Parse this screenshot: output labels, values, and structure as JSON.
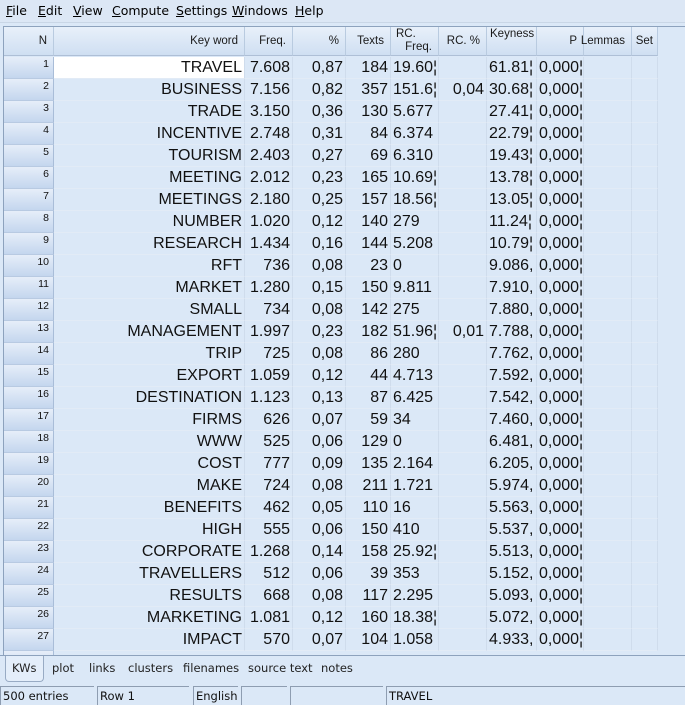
{
  "menu": [
    {
      "label": "File",
      "accel": "F",
      "rest": "ile"
    },
    {
      "label": "Edit",
      "accel": "E",
      "rest": "dit"
    },
    {
      "label": "View",
      "accel": "V",
      "rest": "iew"
    },
    {
      "label": "Compute",
      "accel": "C",
      "rest": "ompute"
    },
    {
      "label": "Settings",
      "accel": "S",
      "rest": "ettings"
    },
    {
      "label": "Windows",
      "accel": "W",
      "rest": "indows"
    },
    {
      "label": "Help",
      "accel": "H",
      "rest": "elp"
    }
  ],
  "columns": {
    "n": "N",
    "keyword": "Key word",
    "freq": "Freq.",
    "pct": "%",
    "texts": "Texts",
    "rc_freq_1": "RC.",
    "rc_freq_2": "Freq.",
    "rc_pct": "RC. %",
    "keyness": "Keyness",
    "p": "P",
    "lemmas": "Lemmas",
    "set": "Set"
  },
  "rows": [
    {
      "n": "1",
      "kw": "TRAVEL",
      "freq": "7.608",
      "pct": "0,87",
      "texts": "184",
      "rcf": "19.60¦",
      "rcp": "",
      "key": "61.81¦",
      "p": "0,000¦"
    },
    {
      "n": "2",
      "kw": "BUSINESS",
      "freq": "7.156",
      "pct": "0,82",
      "texts": "357",
      "rcf": "151.6¦",
      "rcp": "0,04",
      "key": "30.68¦",
      "p": "0,000¦"
    },
    {
      "n": "3",
      "kw": "TRADE",
      "freq": "3.150",
      "pct": "0,36",
      "texts": "130",
      "rcf": "5.677",
      "rcp": "",
      "key": "27.41¦",
      "p": "0,000¦"
    },
    {
      "n": "4",
      "kw": "INCENTIVE",
      "freq": "2.748",
      "pct": "0,31",
      "texts": "84",
      "rcf": "6.374",
      "rcp": "",
      "key": "22.79¦",
      "p": "0,000¦"
    },
    {
      "n": "5",
      "kw": "TOURISM",
      "freq": "2.403",
      "pct": "0,27",
      "texts": "69",
      "rcf": "6.310",
      "rcp": "",
      "key": "19.43¦",
      "p": "0,000¦"
    },
    {
      "n": "6",
      "kw": "MEETING",
      "freq": "2.012",
      "pct": "0,23",
      "texts": "165",
      "rcf": "10.69¦",
      "rcp": "",
      "key": "13.78¦",
      "p": "0,000¦"
    },
    {
      "n": "7",
      "kw": "MEETINGS",
      "freq": "2.180",
      "pct": "0,25",
      "texts": "157",
      "rcf": "18.56¦",
      "rcp": "",
      "key": "13.05¦",
      "p": "0,000¦"
    },
    {
      "n": "8",
      "kw": "NUMBER",
      "freq": "1.020",
      "pct": "0,12",
      "texts": "140",
      "rcf": "279",
      "rcp": "",
      "key": "11.24¦",
      "p": "0,000¦"
    },
    {
      "n": "9",
      "kw": "RESEARCH",
      "freq": "1.434",
      "pct": "0,16",
      "texts": "144",
      "rcf": "5.208",
      "rcp": "",
      "key": "10.79¦",
      "p": "0,000¦"
    },
    {
      "n": "10",
      "kw": "RFT",
      "freq": "736",
      "pct": "0,08",
      "texts": "23",
      "rcf": "0",
      "rcp": "",
      "key": "9.086,",
      "p": "0,000¦"
    },
    {
      "n": "11",
      "kw": "MARKET",
      "freq": "1.280",
      "pct": "0,15",
      "texts": "150",
      "rcf": "9.811",
      "rcp": "",
      "key": "7.910,",
      "p": "0,000¦"
    },
    {
      "n": "12",
      "kw": "SMALL",
      "freq": "734",
      "pct": "0,08",
      "texts": "142",
      "rcf": "275",
      "rcp": "",
      "key": "7.880,",
      "p": "0,000¦"
    },
    {
      "n": "13",
      "kw": "MANAGEMENT",
      "freq": "1.997",
      "pct": "0,23",
      "texts": "182",
      "rcf": "51.96¦",
      "rcp": "0,01",
      "key": "7.788,",
      "p": "0,000¦"
    },
    {
      "n": "14",
      "kw": "TRIP",
      "freq": "725",
      "pct": "0,08",
      "texts": "86",
      "rcf": "280",
      "rcp": "",
      "key": "7.762,",
      "p": "0,000¦"
    },
    {
      "n": "15",
      "kw": "EXPORT",
      "freq": "1.059",
      "pct": "0,12",
      "texts": "44",
      "rcf": "4.713",
      "rcp": "",
      "key": "7.592,",
      "p": "0,000¦"
    },
    {
      "n": "16",
      "kw": "DESTINATION",
      "freq": "1.123",
      "pct": "0,13",
      "texts": "87",
      "rcf": "6.425",
      "rcp": "",
      "key": "7.542,",
      "p": "0,000¦"
    },
    {
      "n": "17",
      "kw": "FIRMS",
      "freq": "626",
      "pct": "0,07",
      "texts": "59",
      "rcf": "34",
      "rcp": "",
      "key": "7.460,",
      "p": "0,000¦"
    },
    {
      "n": "18",
      "kw": "WWW",
      "freq": "525",
      "pct": "0,06",
      "texts": "129",
      "rcf": "0",
      "rcp": "",
      "key": "6.481,",
      "p": "0,000¦"
    },
    {
      "n": "19",
      "kw": "COST",
      "freq": "777",
      "pct": "0,09",
      "texts": "135",
      "rcf": "2.164",
      "rcp": "",
      "key": "6.205,",
      "p": "0,000¦"
    },
    {
      "n": "20",
      "kw": "MAKE",
      "freq": "724",
      "pct": "0,08",
      "texts": "211",
      "rcf": "1.721",
      "rcp": "",
      "key": "5.974,",
      "p": "0,000¦"
    },
    {
      "n": "21",
      "kw": "BENEFITS",
      "freq": "462",
      "pct": "0,05",
      "texts": "110",
      "rcf": "16",
      "rcp": "",
      "key": "5.563,",
      "p": "0,000¦"
    },
    {
      "n": "22",
      "kw": "HIGH",
      "freq": "555",
      "pct": "0,06",
      "texts": "150",
      "rcf": "410",
      "rcp": "",
      "key": "5.537,",
      "p": "0,000¦"
    },
    {
      "n": "23",
      "kw": "CORPORATE",
      "freq": "1.268",
      "pct": "0,14",
      "texts": "158",
      "rcf": "25.92¦",
      "rcp": "",
      "key": "5.513,",
      "p": "0,000¦"
    },
    {
      "n": "24",
      "kw": "TRAVELLERS",
      "freq": "512",
      "pct": "0,06",
      "texts": "39",
      "rcf": "353",
      "rcp": "",
      "key": "5.152,",
      "p": "0,000¦"
    },
    {
      "n": "25",
      "kw": "RESULTS",
      "freq": "668",
      "pct": "0,08",
      "texts": "117",
      "rcf": "2.295",
      "rcp": "",
      "key": "5.093,",
      "p": "0,000¦"
    },
    {
      "n": "26",
      "kw": "MARKETING",
      "freq": "1.081",
      "pct": "0,12",
      "texts": "160",
      "rcf": "18.38¦",
      "rcp": "",
      "key": "5.072,",
      "p": "0,000¦"
    },
    {
      "n": "27",
      "kw": "IMPACT",
      "freq": "570",
      "pct": "0,07",
      "texts": "104",
      "rcf": "1.058",
      "rcp": "",
      "key": "4.933,",
      "p": "0,000¦"
    }
  ],
  "tabs": [
    "KWs",
    "plot",
    "links",
    "clusters",
    "filenames",
    "source text",
    "notes"
  ],
  "active_tab": "KWs",
  "status": {
    "entries": "500 entries",
    "row": "Row 1",
    "language": "English",
    "panel4": "",
    "panel5": "",
    "selected_word": "TRAVEL"
  }
}
